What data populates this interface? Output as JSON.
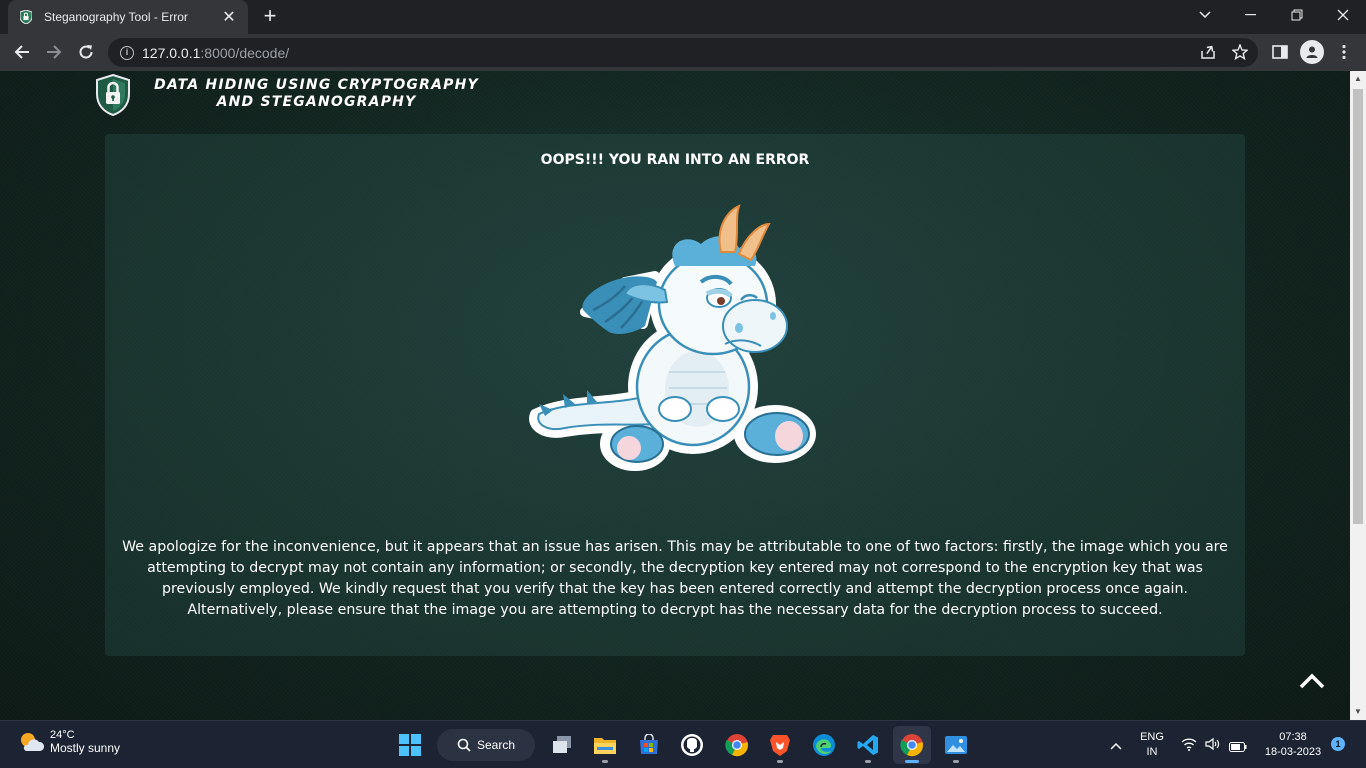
{
  "browser": {
    "tab_title": "Steganography Tool - Error",
    "url_host": "127.0.0.1",
    "url_path": ":8000/decode/"
  },
  "page": {
    "site_title_line1": "DATA HIDING USING CRYPTOGRAPHY",
    "site_title_line2": "AND STEGANOGRAPHY",
    "error_heading": "OOPS!!! YOU RAN INTO AN ERROR",
    "error_message": "We apologize for the inconvenience, but it appears that an issue has arisen. This may be attributable to one of two factors: firstly, the image which you are attempting to decrypt may not contain any information; or secondly, the decryption key entered may not correspond to the encryption key that was previously employed. We kindly request that you verify that the key has been entered correctly and attempt the decryption process once again. Alternatively, please ensure that the image you are attempting to decrypt has the necessary data for the decryption process to succeed."
  },
  "taskbar": {
    "weather_temp": "24°C",
    "weather_condition": "Mostly sunny",
    "search_label": "Search",
    "language_line1": "ENG",
    "language_line2": "IN",
    "time": "07:38",
    "date": "18-03-2023",
    "notification_count": "1"
  },
  "colors": {
    "page_background": "#14302a",
    "card_background": "#24463f",
    "accent": "#5fb2ff"
  },
  "icons": [
    "shield-lock-icon",
    "back-icon",
    "forward-icon",
    "reload-icon",
    "info-icon",
    "share-icon",
    "star-icon",
    "sidepanel-icon",
    "profile-icon",
    "menu-icon",
    "chevron-up-icon",
    "windows-start-icon",
    "search-icon",
    "task-view-icon",
    "file-explorer-icon",
    "store-icon",
    "github-icon",
    "chrome-icon",
    "brave-icon",
    "edge-icon",
    "vscode-icon",
    "photos-icon",
    "wifi-icon",
    "volume-icon",
    "battery-icon"
  ]
}
